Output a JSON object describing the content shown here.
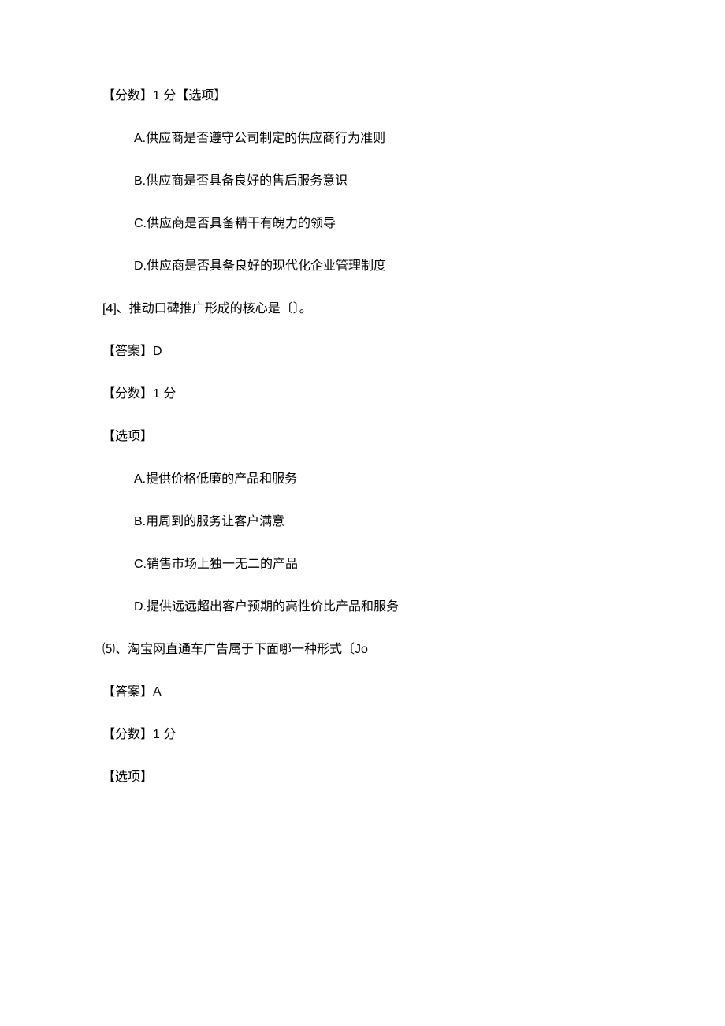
{
  "q3": {
    "meta_prefix": "【分数】1 分【选项】",
    "options": {
      "A": "A.供应商是否遵守公司制定的供应商行为准则",
      "B": "B.供应商是否具备良好的售后服务意识",
      "C": "C.供应商是否具备精干有魄力的领导",
      "D": "D.供应商是否具备良好的现代化企业管理制度"
    }
  },
  "q4": {
    "question": "[4]、推动口碑推广形成的核心是〔〕。",
    "answer": "【答案】D",
    "score": "【分数】1 分",
    "options_label": "【选项】",
    "options": {
      "A": "A.提供价格低廉的产品和服务",
      "B": "B.用周到的服务让客户满意",
      "C": "C.销售市场上独一无二的产品",
      "D": "D.提供远远超出客户预期的高性价比产品和服务"
    }
  },
  "q5": {
    "question": "⑸、淘宝网直通车广告属于下面哪一种形式〔Jo",
    "answer": "【答案】A",
    "score": "【分数】1 分",
    "options_label": "【选项】"
  }
}
